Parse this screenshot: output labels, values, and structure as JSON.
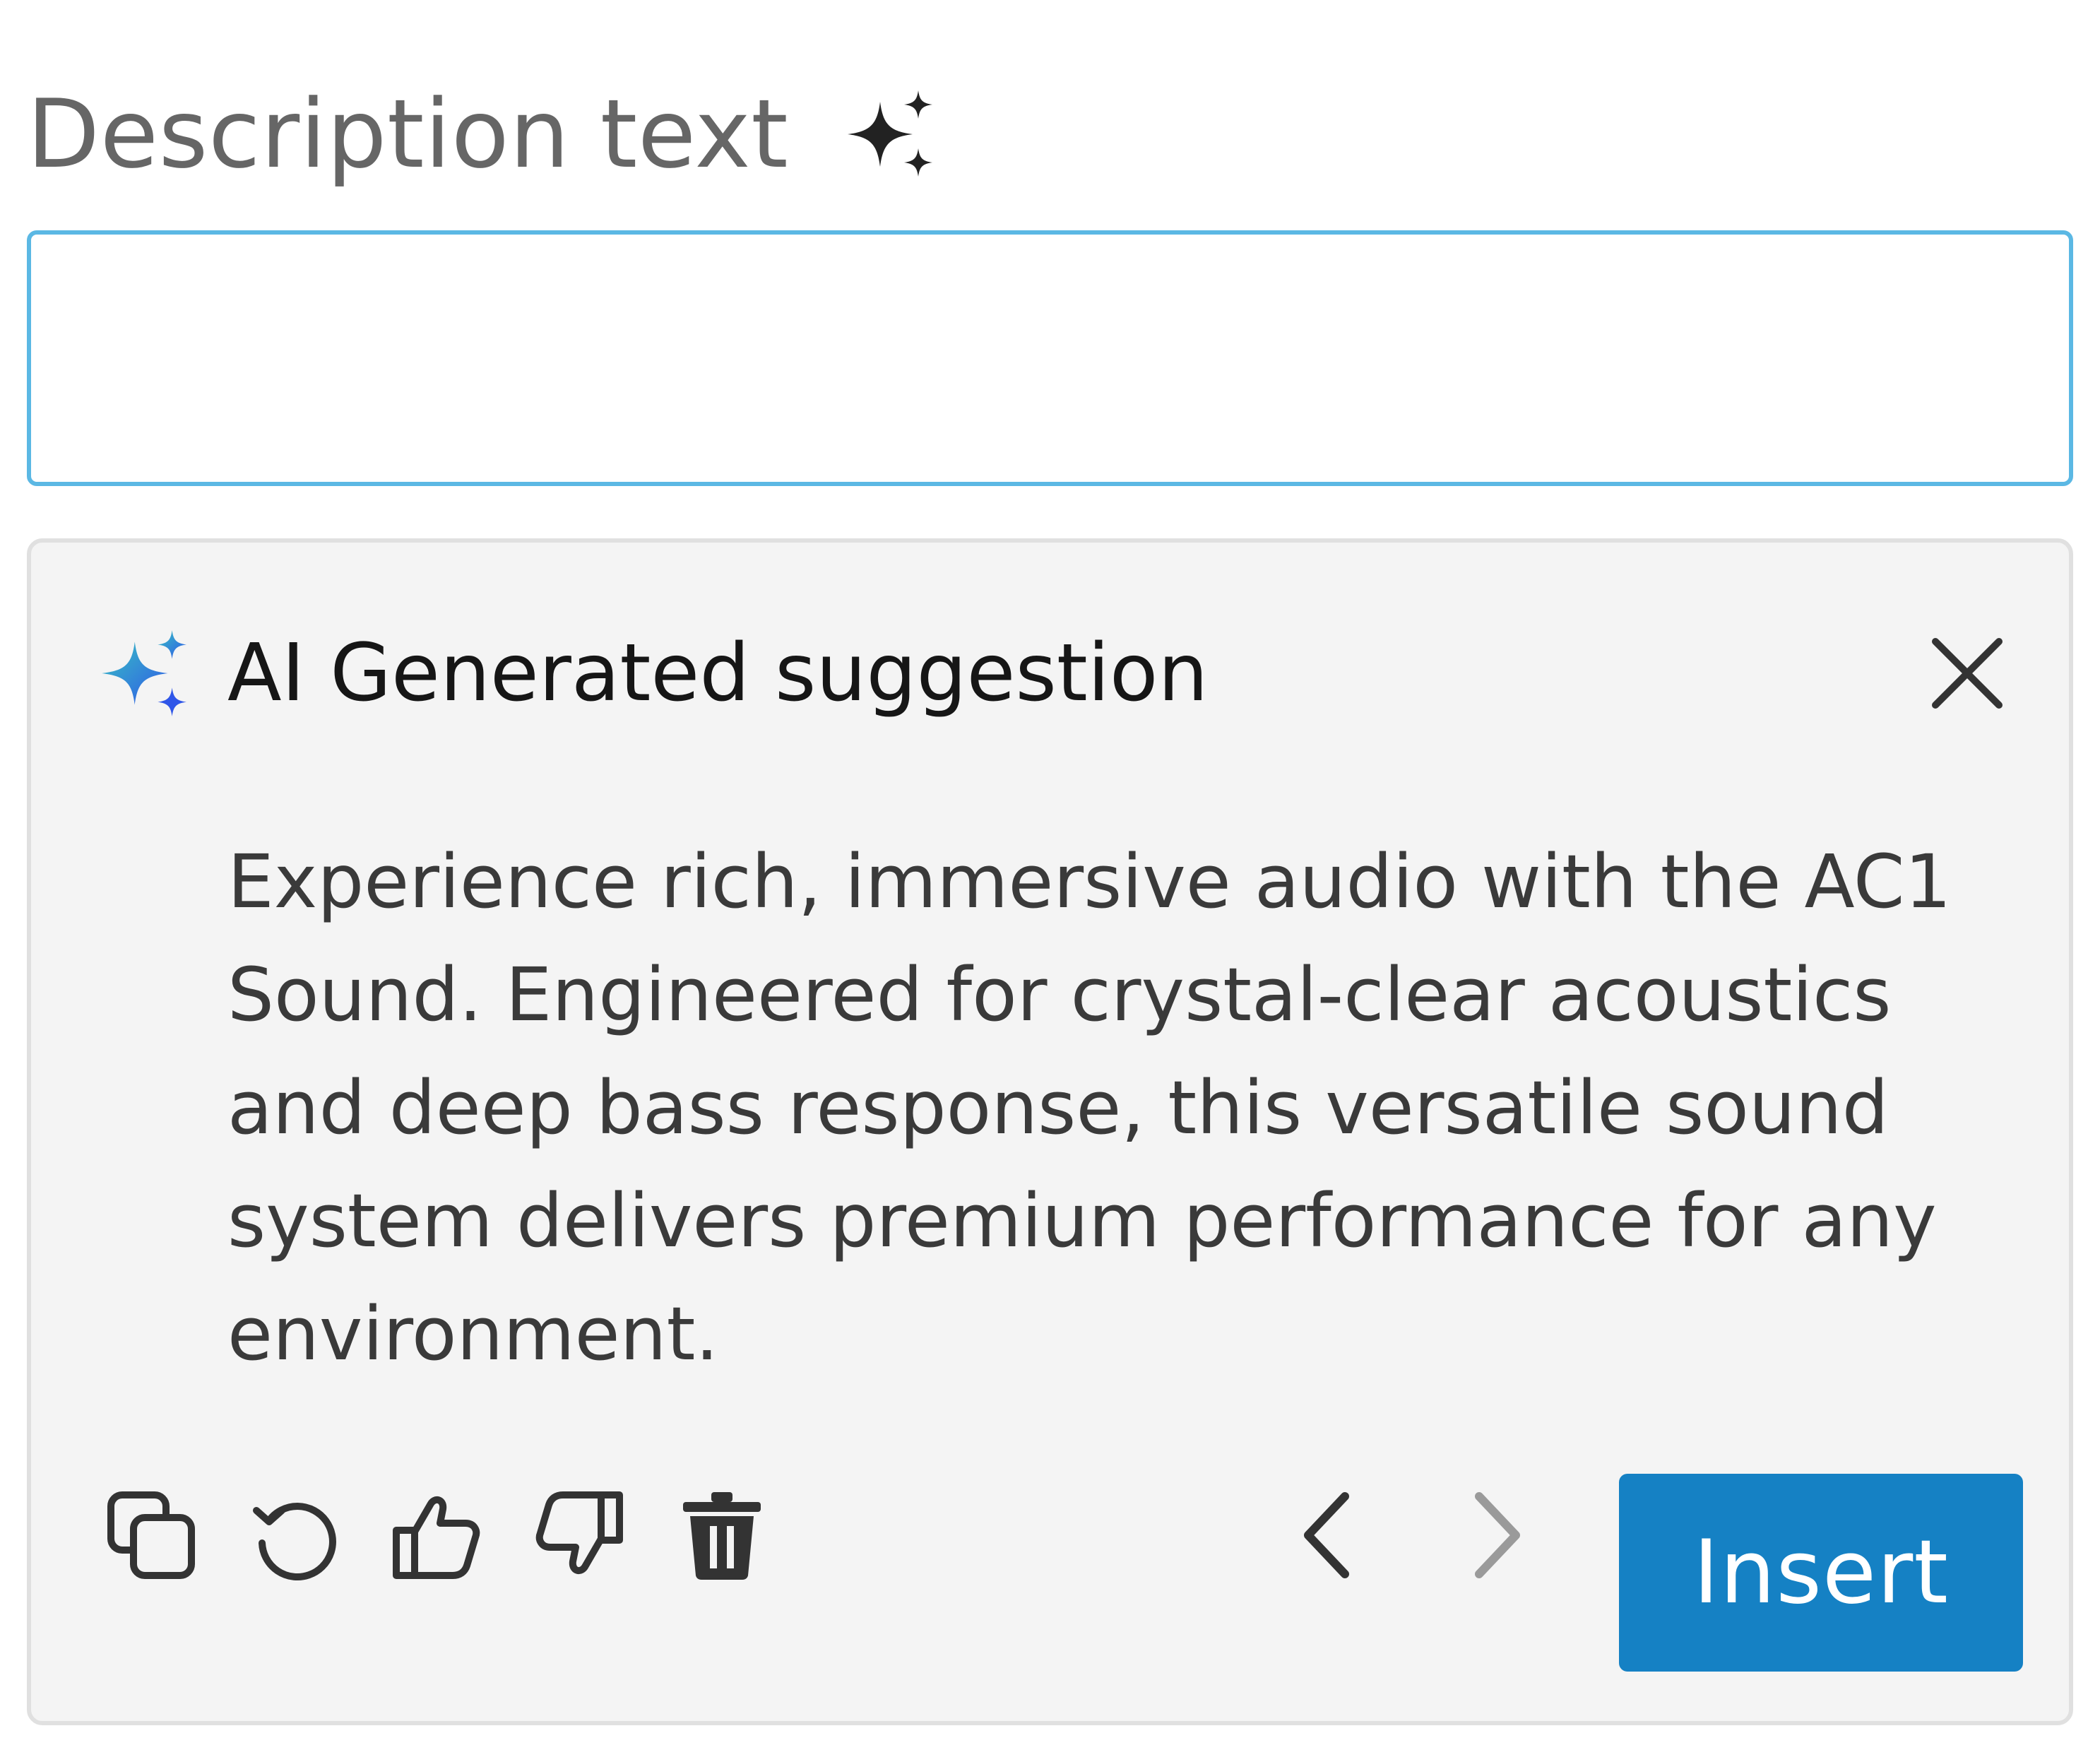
{
  "field": {
    "label": "Description text",
    "label_icon": "sparkles-icon",
    "input_value": "",
    "input_placeholder": ""
  },
  "suggestion_panel": {
    "icon": "ai-sparkle-icon",
    "title": "AI Generated suggestion",
    "close_icon": "close-icon",
    "body": "Experience rich, immersive audio with the AC1 Sound. Engineered for crystal-clear acoustics and deep bass response, this versatile sound system delivers premium performance for any environment.",
    "toolbar": {
      "icons": [
        "copy-icon",
        "regenerate-icon",
        "thumbs-up-icon",
        "thumbs-down-icon",
        "trash-icon"
      ]
    },
    "nav": {
      "prev_icon": "chevron-left-icon",
      "next_icon": "chevron-right-icon",
      "next_disabled": true
    },
    "insert_label": "Insert"
  },
  "colors": {
    "input_border": "#5bb8e4",
    "panel_bg": "#f4f4f4",
    "panel_border": "#e0e0e0",
    "insert_bg": "#1581c4",
    "ai_gradient_start": "#38c3c3",
    "ai_gradient_end": "#2f56e8",
    "icon_dark": "#333333",
    "icon_disabled": "#9a9a9a"
  }
}
